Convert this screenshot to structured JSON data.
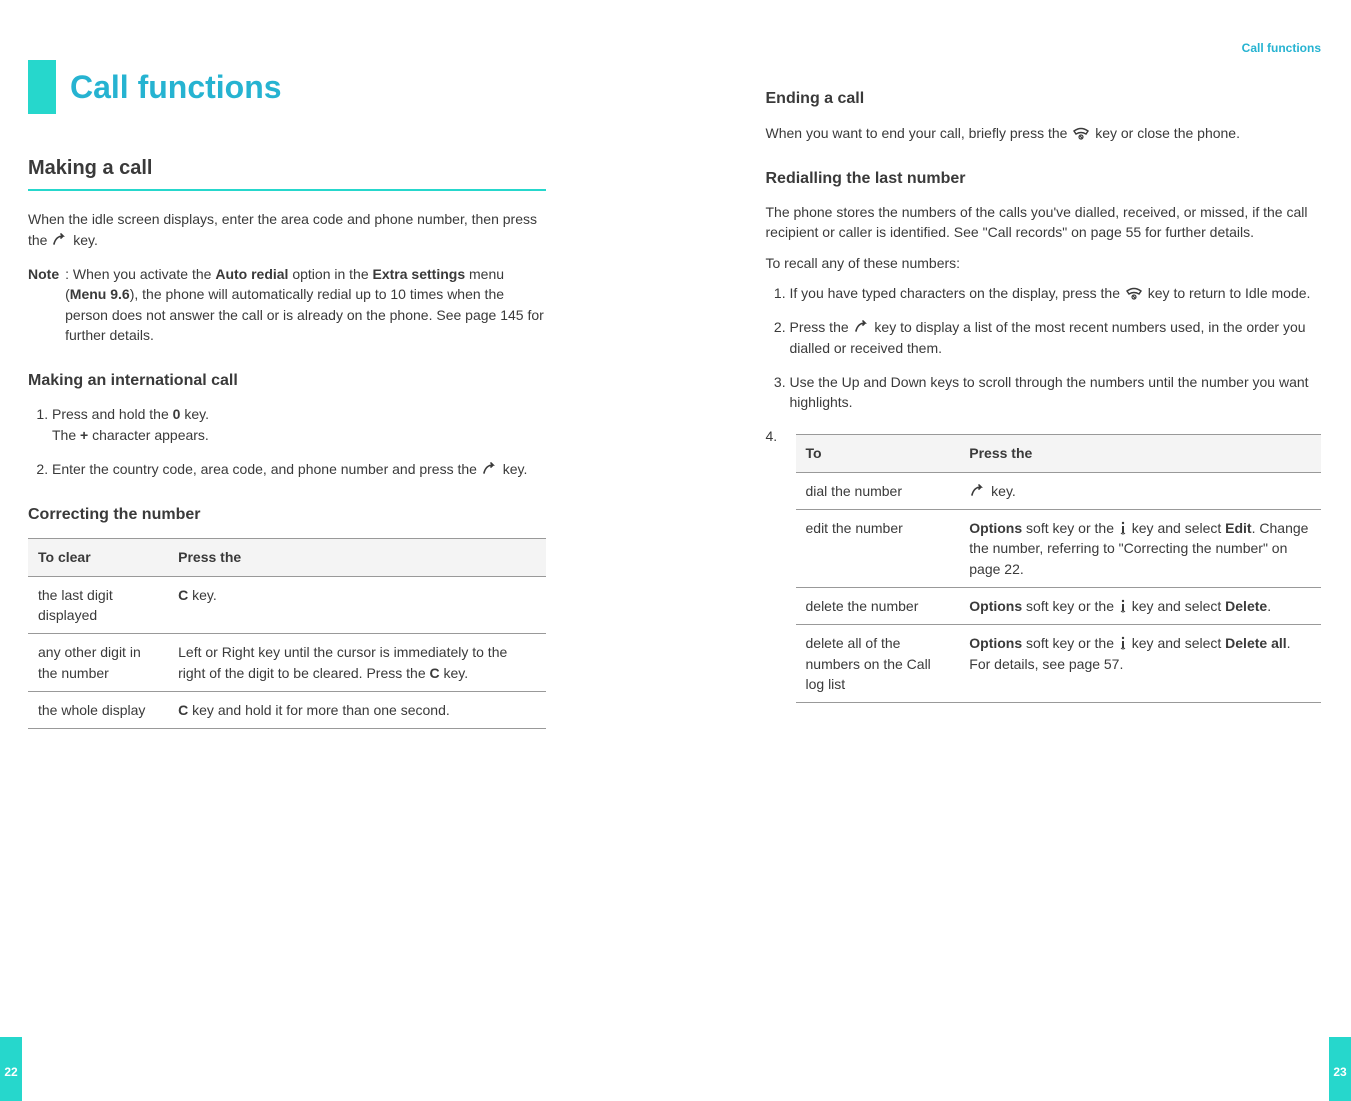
{
  "running_head": "Call functions",
  "page_numbers": {
    "left": "22",
    "right": "23"
  },
  "chapter_title": "Call functions",
  "left": {
    "section1_title": "Making a call",
    "intro_a": "When the idle screen displays, enter the area code and phone number, then press the ",
    "intro_b": " key.",
    "note_label": "Note",
    "note_a": ": When you activate the ",
    "note_b": "Auto redial",
    "note_c": " option in the ",
    "note_d": "Extra settings",
    "note_e": " menu (",
    "note_f": "Menu 9.6",
    "note_g": "), the phone will automatically redial up to 10 times when the person does not answer the call or is already on the phone. See page 145 for further details.",
    "sub1_title": "Making an international call",
    "step1a": "Press and hold the ",
    "step1a_b": "0",
    "step1a_c": " key.",
    "step1a_line2a": "The ",
    "step1a_line2b": "+",
    "step1a_line2c": " character appears.",
    "step1b_a": "Enter the country code, area code, and phone number and press the ",
    "step1b_b": " key.",
    "sub2_title": "Correcting the number",
    "table1": {
      "h1": "To clear",
      "h2": "Press the",
      "r1c1": "the last digit displayed",
      "r1c2a": "C",
      "r1c2b": " key.",
      "r2c1": "any other digit in the number",
      "r2c2a": "Left or Right key until the cursor is immediately to the right of the digit to be cleared. Press the ",
      "r2c2b": "C",
      "r2c2c": " key.",
      "r3c1": "the whole display",
      "r3c2a": "C",
      "r3c2b": " key and hold it for more than one second."
    }
  },
  "right": {
    "sub3_title": "Ending a call",
    "end_a": "When you want to end your call, briefly press the ",
    "end_b": " key or close the phone.",
    "sub4_title": "Redialling the last number",
    "redial_para": "The phone stores the numbers of the calls you've dialled, received, or missed, if the call recipient or caller is identified. See \"Call records\" on page 55 for further details.",
    "recall_intro": "To recall any of these numbers:",
    "step_r1_a": "If you have typed characters on the display, press the ",
    "step_r1_b": " key to return to Idle mode.",
    "step_r2_a": "Press the ",
    "step_r2_b": " key to display a list of the most recent numbers used, in the order you dialled or received them.",
    "step_r3": "Use the Up and Down keys to scroll through the numbers until the number you want highlights.",
    "step4_num": "4.",
    "table2": {
      "h1": "To",
      "h2": "Press the",
      "r1c1": "dial the number",
      "r1c2": " key.",
      "r2c1": "edit the number",
      "r2c2a": "Options",
      "r2c2b": " soft key or the ",
      "r2c2c": " key and select ",
      "r2c2d": "Edit",
      "r2c2e": ". Change the number, referring to \"Correcting the number\" on page 22.",
      "r3c1": "delete the number",
      "r3c2a": "Options",
      "r3c2b": " soft key or the ",
      "r3c2c": " key and select ",
      "r3c2d": "Delete",
      "r3c2e": ".",
      "r4c1": "delete all of the numbers on the Call log list",
      "r4c2a": "Options",
      "r4c2b": " soft key or the ",
      "r4c2c": " key and select ",
      "r4c2d": "Delete all",
      "r4c2e": ". For details, see page 57."
    }
  }
}
